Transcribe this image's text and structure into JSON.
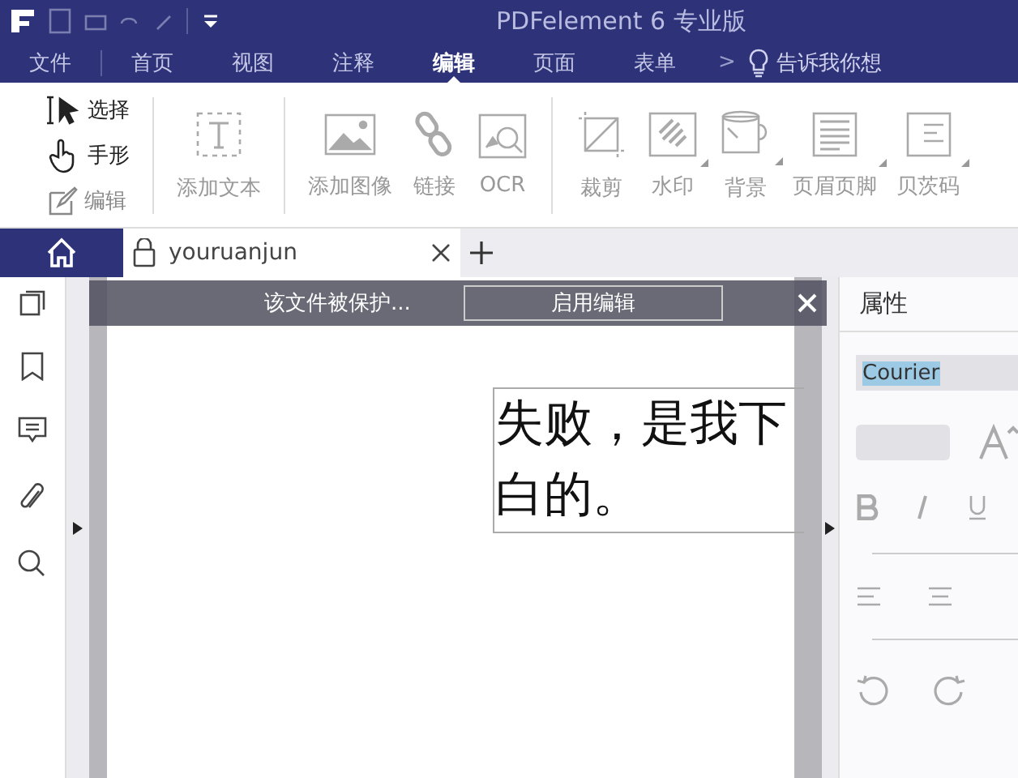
{
  "window": {
    "title": "PDFelement  6  专业版"
  },
  "menu": {
    "items": [
      {
        "label": "文件",
        "selected": false
      },
      {
        "label": "首页",
        "selected": false
      },
      {
        "label": "视图",
        "selected": false
      },
      {
        "label": "注释",
        "selected": false
      },
      {
        "label": "编辑",
        "selected": true
      },
      {
        "label": "页面",
        "selected": false
      },
      {
        "label": "表单",
        "selected": false
      }
    ],
    "more": ">",
    "tell_me": "告诉我你想"
  },
  "ribbon": {
    "modes": [
      {
        "label": "选择",
        "disabled": false
      },
      {
        "label": "手形",
        "disabled": false
      },
      {
        "label": "编辑",
        "disabled": true
      }
    ],
    "groups": [
      [
        {
          "label": "添加文本",
          "dropdown": false
        }
      ],
      [
        {
          "label": "添加图像",
          "dropdown": false
        },
        {
          "label": "链接",
          "dropdown": false
        },
        {
          "label": "OCR",
          "dropdown": false
        }
      ],
      [
        {
          "label": "裁剪",
          "dropdown": false
        },
        {
          "label": "水印",
          "dropdown": true
        },
        {
          "label": "背景",
          "dropdown": true
        },
        {
          "label": "页眉页脚",
          "dropdown": true
        },
        {
          "label": "贝茨码",
          "dropdown": true
        }
      ]
    ]
  },
  "tabs": [
    {
      "label": "youruanjun",
      "selected": true,
      "locked": true
    }
  ],
  "notice": {
    "text": "该文件被保护...",
    "button": "启用编辑"
  },
  "document": {
    "lines": [
      "失败，是我下",
      "白的。"
    ]
  },
  "properties": {
    "title": "属性",
    "font": "Courier",
    "font_selected": true
  }
}
